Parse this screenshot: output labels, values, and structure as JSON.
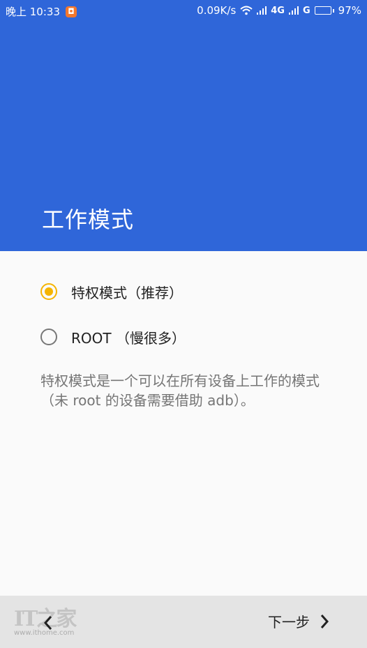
{
  "status_bar": {
    "time": "晚上 10:33",
    "net_speed": "0.09K/s",
    "network_type": "4G",
    "network_type_2": "G",
    "battery_percent": "97%",
    "battery_level": 0.97,
    "icons": [
      "app-notification-icon",
      "wifi-icon",
      "signal-icon",
      "signal-icon-2",
      "battery-icon"
    ]
  },
  "header": {
    "title": "工作模式",
    "color": "#2f66d9"
  },
  "options": [
    {
      "label": "特权模式（推荐）",
      "selected": true
    },
    {
      "label": "ROOT （慢很多）",
      "selected": false
    }
  ],
  "description": "特权模式是一个可以在所有设备上工作的模式（未 root 的设备需要借助 adb）。",
  "bottom_bar": {
    "next_label": "下一步",
    "watermark_logo": "IT之家",
    "watermark_url": "www.ithome.com"
  },
  "accent_color": "#f5b400"
}
